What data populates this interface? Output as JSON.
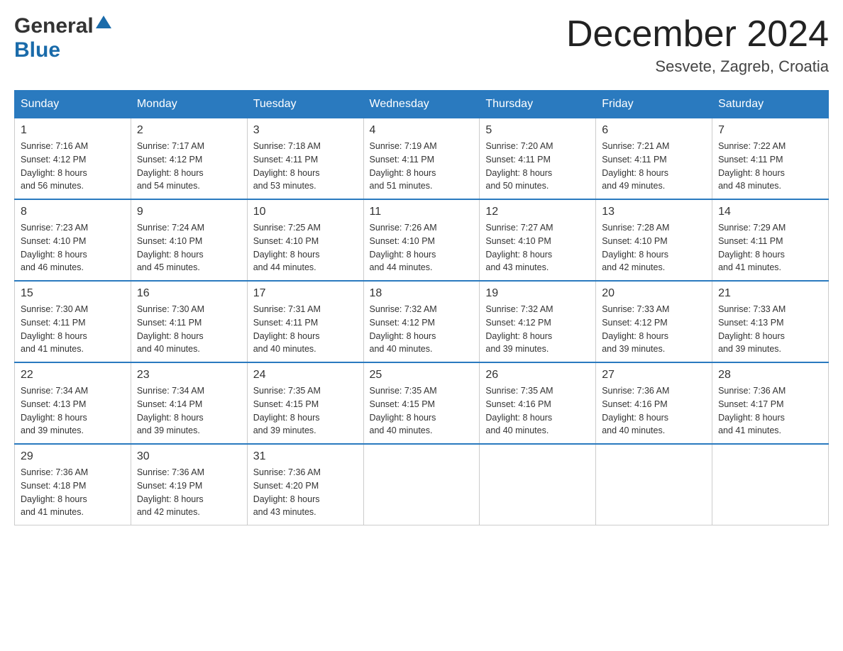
{
  "header": {
    "logo": {
      "general": "General",
      "blue": "Blue",
      "triangle": "▲"
    },
    "title": "December 2024",
    "location": "Sesvete, Zagreb, Croatia"
  },
  "days_of_week": [
    "Sunday",
    "Monday",
    "Tuesday",
    "Wednesday",
    "Thursday",
    "Friday",
    "Saturday"
  ],
  "weeks": [
    [
      {
        "day": "1",
        "sunrise": "7:16 AM",
        "sunset": "4:12 PM",
        "daylight": "8 hours and 56 minutes."
      },
      {
        "day": "2",
        "sunrise": "7:17 AM",
        "sunset": "4:12 PM",
        "daylight": "8 hours and 54 minutes."
      },
      {
        "day": "3",
        "sunrise": "7:18 AM",
        "sunset": "4:11 PM",
        "daylight": "8 hours and 53 minutes."
      },
      {
        "day": "4",
        "sunrise": "7:19 AM",
        "sunset": "4:11 PM",
        "daylight": "8 hours and 51 minutes."
      },
      {
        "day": "5",
        "sunrise": "7:20 AM",
        "sunset": "4:11 PM",
        "daylight": "8 hours and 50 minutes."
      },
      {
        "day": "6",
        "sunrise": "7:21 AM",
        "sunset": "4:11 PM",
        "daylight": "8 hours and 49 minutes."
      },
      {
        "day": "7",
        "sunrise": "7:22 AM",
        "sunset": "4:11 PM",
        "daylight": "8 hours and 48 minutes."
      }
    ],
    [
      {
        "day": "8",
        "sunrise": "7:23 AM",
        "sunset": "4:10 PM",
        "daylight": "8 hours and 46 minutes."
      },
      {
        "day": "9",
        "sunrise": "7:24 AM",
        "sunset": "4:10 PM",
        "daylight": "8 hours and 45 minutes."
      },
      {
        "day": "10",
        "sunrise": "7:25 AM",
        "sunset": "4:10 PM",
        "daylight": "8 hours and 44 minutes."
      },
      {
        "day": "11",
        "sunrise": "7:26 AM",
        "sunset": "4:10 PM",
        "daylight": "8 hours and 44 minutes."
      },
      {
        "day": "12",
        "sunrise": "7:27 AM",
        "sunset": "4:10 PM",
        "daylight": "8 hours and 43 minutes."
      },
      {
        "day": "13",
        "sunrise": "7:28 AM",
        "sunset": "4:10 PM",
        "daylight": "8 hours and 42 minutes."
      },
      {
        "day": "14",
        "sunrise": "7:29 AM",
        "sunset": "4:11 PM",
        "daylight": "8 hours and 41 minutes."
      }
    ],
    [
      {
        "day": "15",
        "sunrise": "7:30 AM",
        "sunset": "4:11 PM",
        "daylight": "8 hours and 41 minutes."
      },
      {
        "day": "16",
        "sunrise": "7:30 AM",
        "sunset": "4:11 PM",
        "daylight": "8 hours and 40 minutes."
      },
      {
        "day": "17",
        "sunrise": "7:31 AM",
        "sunset": "4:11 PM",
        "daylight": "8 hours and 40 minutes."
      },
      {
        "day": "18",
        "sunrise": "7:32 AM",
        "sunset": "4:12 PM",
        "daylight": "8 hours and 40 minutes."
      },
      {
        "day": "19",
        "sunrise": "7:32 AM",
        "sunset": "4:12 PM",
        "daylight": "8 hours and 39 minutes."
      },
      {
        "day": "20",
        "sunrise": "7:33 AM",
        "sunset": "4:12 PM",
        "daylight": "8 hours and 39 minutes."
      },
      {
        "day": "21",
        "sunrise": "7:33 AM",
        "sunset": "4:13 PM",
        "daylight": "8 hours and 39 minutes."
      }
    ],
    [
      {
        "day": "22",
        "sunrise": "7:34 AM",
        "sunset": "4:13 PM",
        "daylight": "8 hours and 39 minutes."
      },
      {
        "day": "23",
        "sunrise": "7:34 AM",
        "sunset": "4:14 PM",
        "daylight": "8 hours and 39 minutes."
      },
      {
        "day": "24",
        "sunrise": "7:35 AM",
        "sunset": "4:15 PM",
        "daylight": "8 hours and 39 minutes."
      },
      {
        "day": "25",
        "sunrise": "7:35 AM",
        "sunset": "4:15 PM",
        "daylight": "8 hours and 40 minutes."
      },
      {
        "day": "26",
        "sunrise": "7:35 AM",
        "sunset": "4:16 PM",
        "daylight": "8 hours and 40 minutes."
      },
      {
        "day": "27",
        "sunrise": "7:36 AM",
        "sunset": "4:16 PM",
        "daylight": "8 hours and 40 minutes."
      },
      {
        "day": "28",
        "sunrise": "7:36 AM",
        "sunset": "4:17 PM",
        "daylight": "8 hours and 41 minutes."
      }
    ],
    [
      {
        "day": "29",
        "sunrise": "7:36 AM",
        "sunset": "4:18 PM",
        "daylight": "8 hours and 41 minutes."
      },
      {
        "day": "30",
        "sunrise": "7:36 AM",
        "sunset": "4:19 PM",
        "daylight": "8 hours and 42 minutes."
      },
      {
        "day": "31",
        "sunrise": "7:36 AM",
        "sunset": "4:20 PM",
        "daylight": "8 hours and 43 minutes."
      },
      null,
      null,
      null,
      null
    ]
  ],
  "labels": {
    "sunrise": "Sunrise:",
    "sunset": "Sunset:",
    "daylight": "Daylight:"
  }
}
